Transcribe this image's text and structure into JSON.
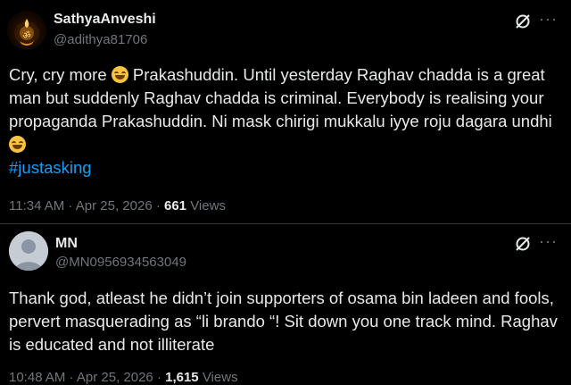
{
  "tweet1": {
    "display_name": "SathyaAnveshi",
    "handle": "@adithya81706",
    "text_part1": "Cry, cry more ",
    "text_part2": " Prakashuddin. Until yesterday Raghav chadda is a great man but suddenly Raghav chadda is criminal. Everybody is realising your propaganda Prakashuddin. Ni mask chirigi mukkalu iyye roju dagara undhi",
    "hashtag": "#justasking",
    "time": "11:34 AM · Apr 25, 2026 · ",
    "views_count": "661",
    "views_label": " Views",
    "emoji": "laughing-with-tears-emoji"
  },
  "tweet2": {
    "display_name": "MN",
    "handle": "@MN0956934563049",
    "text": "Thank god, atleast he didn’t join supporters of osama bin ladeen and fools, pervert masquerading as “li brando “! Sit down you one track mind. Raghav is educated and not illiterate",
    "time": "10:48 AM · Apr 25, 2026 · ",
    "views_count": "1,615",
    "views_label": " Views"
  },
  "icons": {
    "grok": "grok-icon",
    "more": "more-icon",
    "more_glyph": "···"
  },
  "colors": {
    "background": "#000000",
    "text": "#e7e9ea",
    "secondary": "#71767b",
    "link": "#1d9bf0"
  }
}
